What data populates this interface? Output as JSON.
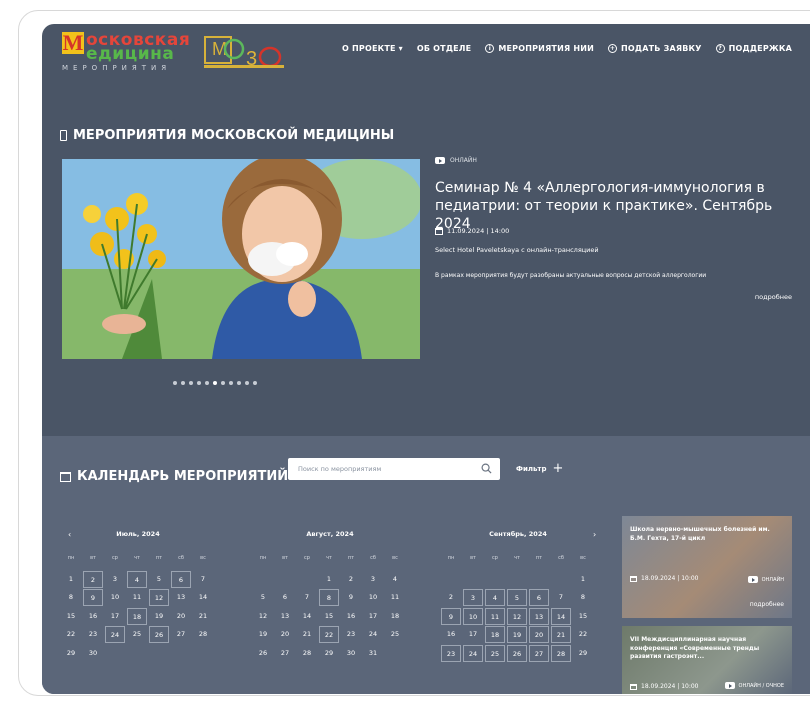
{
  "logo": {
    "letter": "М",
    "line1": "осковская",
    "line2": "едицина",
    "sub": "МЕРОПРИЯТИЯ",
    "mo30": "MO30"
  },
  "nav": [
    {
      "label": "О ПРОЕКТЕ ▾",
      "icon": ""
    },
    {
      "label": "ОБ ОТДЕЛЕ",
      "icon": ""
    },
    {
      "label": "МЕРОПРИЯТИЯ НИИ",
      "icon": "info-icon"
    },
    {
      "label": "ПОДАТЬ ЗАЯВКУ",
      "icon": "plus-circle-icon"
    },
    {
      "label": "ПОДДЕРЖКА",
      "icon": "question-icon"
    }
  ],
  "events": {
    "section_title": "МЕРОПРИЯТИЯ МОСКОВСКОЙ МЕДИЦИНЫ",
    "badge": "ОНЛАЙН",
    "title": "Семинар № 4 «Аллергология-иммунология в педиатрии: от теории к практике». Сентябрь 2024",
    "date": "11.09.2024 | 14:00",
    "place": "Select Hotel Paveletskaya с онлайн-трансляцией",
    "description": "В рамках мероприятия будут разобраны актуальные вопросы детской аллергологии",
    "more": "подробнее",
    "slides_count": 11,
    "active_slide": 5
  },
  "calendar": {
    "title": "КАЛЕНДАРЬ МЕРОПРИЯТИЙ",
    "search_placeholder": "Поиск по мероприятиям",
    "filter_label": "Фильтр",
    "filter_plus": "+",
    "prev": "‹",
    "next": "›",
    "weekdays": [
      "пн",
      "вт",
      "ср",
      "чт",
      "пт",
      "сб",
      "вс"
    ],
    "months": [
      {
        "name": "Июль, 2024",
        "offset": 0,
        "days": 31,
        "visible_days": 30,
        "boxed": [
          2,
          4,
          6,
          9,
          12,
          18,
          24,
          26
        ]
      },
      {
        "name": "Август, 2024",
        "offset": 3,
        "days": 31,
        "visible_days": 31,
        "boxed": [
          8,
          22
        ]
      },
      {
        "name": "Сентябрь, 2024",
        "offset": 6,
        "days": 30,
        "visible_days": 29,
        "boxed": [
          3,
          4,
          5,
          6,
          9,
          10,
          11,
          12,
          13,
          14,
          18,
          19,
          20,
          21,
          23,
          24,
          25,
          26,
          27,
          28
        ]
      }
    ]
  },
  "cards": [
    {
      "title": "Школа нервно-мышечных болезней им. Б.М. Гехта, 17-й цикл",
      "date": "18.09.2024 | 10:00",
      "badge": "ОНЛАЙН",
      "more": "подробнее"
    },
    {
      "title": "VII Междисциплинарная научная конференция «Современные тренды развития гастроэнт...",
      "date": "18.09.2024 | 10:00",
      "badge": "ОНЛАЙН / ОЧНОЕ"
    }
  ]
}
